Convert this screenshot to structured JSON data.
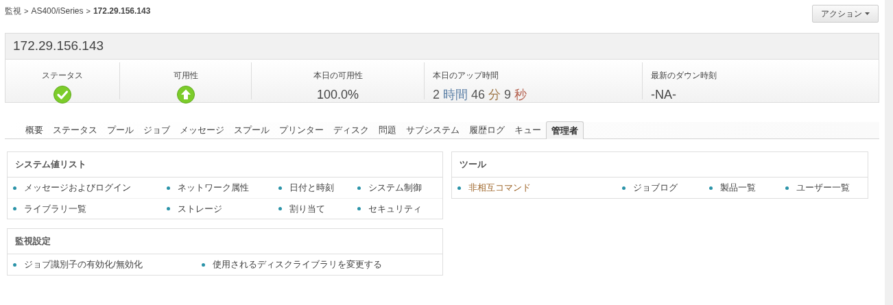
{
  "breadcrumb": [
    {
      "label": "監視",
      "current": false
    },
    {
      "label": "AS400/iSeries",
      "current": false
    },
    {
      "label": "172.29.156.143",
      "current": true
    }
  ],
  "breadcrumb_separator": ">",
  "action_button": {
    "label": "アクション"
  },
  "monitor": {
    "title": "172.29.156.143",
    "stats": [
      {
        "kind": "check",
        "label": "ステータス"
      },
      {
        "kind": "arrow",
        "label": "可用性"
      },
      {
        "kind": "value",
        "label": "本日の可用性",
        "value": "100.0%"
      },
      {
        "kind": "duration",
        "label": "本日のアップ時間",
        "parts": [
          {
            "value": "2",
            "unit": "時間",
            "color": "#5b7fa6"
          },
          {
            "value": "46",
            "unit": "分",
            "color": "#a07a4a"
          },
          {
            "value": "9",
            "unit": "秒",
            "color": "#b5614f"
          }
        ]
      },
      {
        "kind": "value",
        "label": "最新のダウン時刻",
        "value": "-NA-"
      }
    ]
  },
  "tabs": [
    {
      "label": "概要",
      "selected": false
    },
    {
      "label": "ステータス",
      "selected": false
    },
    {
      "label": "プール",
      "selected": false
    },
    {
      "label": "ジョブ",
      "selected": false
    },
    {
      "label": "メッセージ",
      "selected": false
    },
    {
      "label": "スプール",
      "selected": false
    },
    {
      "label": "プリンター",
      "selected": false
    },
    {
      "label": "ディスク",
      "selected": false
    },
    {
      "label": "問題",
      "selected": false
    },
    {
      "label": "サブシステム",
      "selected": false
    },
    {
      "label": "履歴ログ",
      "selected": false
    },
    {
      "label": "キュー",
      "selected": false
    },
    {
      "label": "管理者",
      "selected": true
    }
  ],
  "panels": [
    {
      "title": "システム値リスト",
      "links": [
        {
          "label": "メッセージおよびログイン",
          "active": false
        },
        {
          "label": "ネットワーク属性",
          "active": false
        },
        {
          "label": "日付と時刻",
          "active": false
        },
        {
          "label": "システム制御",
          "active": false
        },
        {
          "label": "ライブラリ一覧",
          "active": false
        },
        {
          "label": "ストレージ",
          "active": false
        },
        {
          "label": "割り当て",
          "active": false
        },
        {
          "label": "セキュリティ",
          "active": false
        }
      ]
    },
    {
      "title": "監視設定",
      "links": [
        {
          "label": "ジョブ識別子の有効化/無効化",
          "active": false
        },
        {
          "label": "使用されるディスクライブラリを変更する",
          "active": false
        }
      ]
    },
    {
      "title": "ツール",
      "links": [
        {
          "label": "非相互コマンド",
          "active": true
        },
        {
          "label": "ジョブログ",
          "active": false
        },
        {
          "label": "製品一覧",
          "active": false
        },
        {
          "label": "ユーザー一覧",
          "active": false
        }
      ]
    }
  ]
}
